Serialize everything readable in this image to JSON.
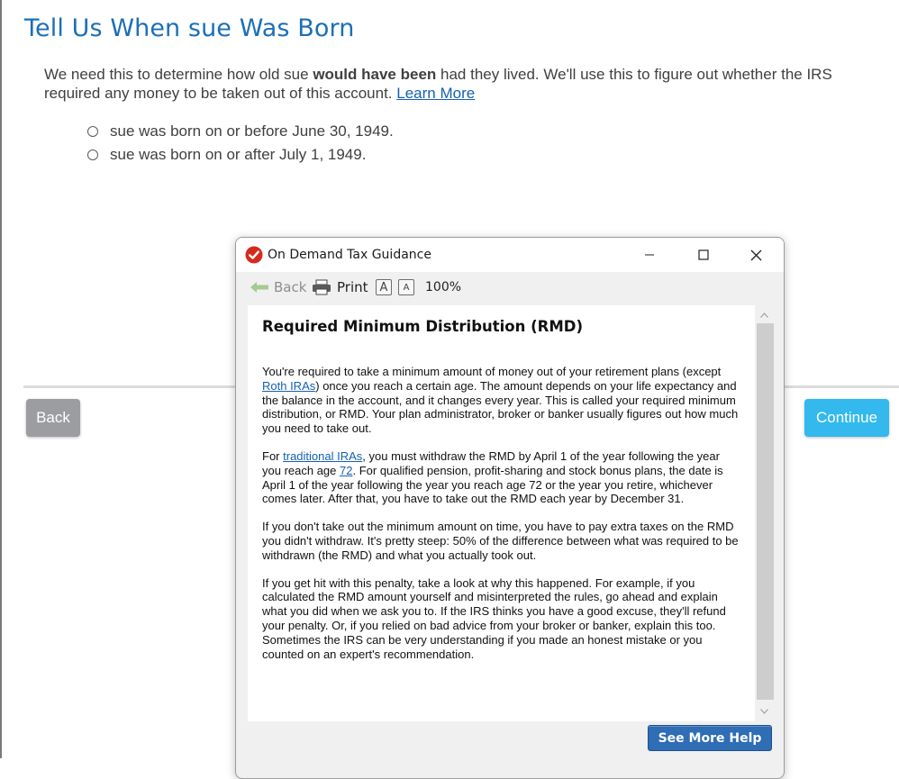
{
  "page": {
    "title": "Tell Us When sue Was Born",
    "intro_part1": "We need this to determine how old sue ",
    "intro_bold": "would have been",
    "intro_part2": " had they lived. We'll use this to figure out whether the IRS required any money to be taken out of this account. ",
    "learn_more": "Learn More",
    "options": [
      {
        "label": "sue was born on or before June 30, 1949.",
        "selected": false
      },
      {
        "label": "sue was born on or after July 1, 1949.",
        "selected": false
      }
    ],
    "back_label": "Back",
    "continue_label": "Continue"
  },
  "modal": {
    "title": "On Demand Tax Guidance",
    "toolbar": {
      "back_label": "Back",
      "print_label": "Print",
      "font_larger": "A",
      "font_smaller": "A",
      "zoom": "100%"
    },
    "heading": "Required Minimum Distribution (RMD)",
    "p1_a": "You're required to take a minimum amount of money out of your retirement plans (except ",
    "p1_link": "Roth IRAs",
    "p1_b": ") once you reach a certain age. The amount depends on your life expectancy and the balance in the account, and it changes every year. This is called your required minimum distribution, or RMD. Your plan administrator, broker or banker usually figures out how much you need to take out.",
    "p2_a": "For ",
    "p2_link1": "traditional IRAs",
    "p2_b": ", you must withdraw the RMD by April 1 of the year following the year you reach age ",
    "p2_link2": "72",
    "p2_c": ". For qualified pension, profit-sharing and stock bonus plans, the date is April 1 of the year following the year you reach age 72 or the year you retire, whichever comes later. After that, you have to take out the RMD each year by December 31.",
    "p3": "If you don't take out the minimum amount on time, you have to pay extra taxes on the RMD you didn't withdraw. It's pretty steep: 50% of the difference between what was required to be withdrawn (the RMD) and what you actually took out.",
    "p4": "If you get hit with this penalty, take a look at why this happened. For example, if you calculated the RMD amount yourself and misinterpreted the rules, go ahead and explain what you did when we ask you to. If the IRS thinks you have a good excuse, they'll refund your penalty. Or, if you relied on bad advice from your broker or banker, explain this too. Sometimes the IRS can be very understanding if you made an honest mistake or you counted on an expert's recommendation.",
    "see_more": "See More Help"
  },
  "colors": {
    "title_blue": "#1b6fb8",
    "link_blue": "#1562b0",
    "continue_bg": "#33b9ee",
    "back_bg": "#9b9da0",
    "see_more_bg": "#2f6db5",
    "check_red": "#d52b1e"
  },
  "icons": {
    "app": "red-checkmark-icon",
    "back": "back-arrow-icon",
    "print": "printer-icon"
  }
}
